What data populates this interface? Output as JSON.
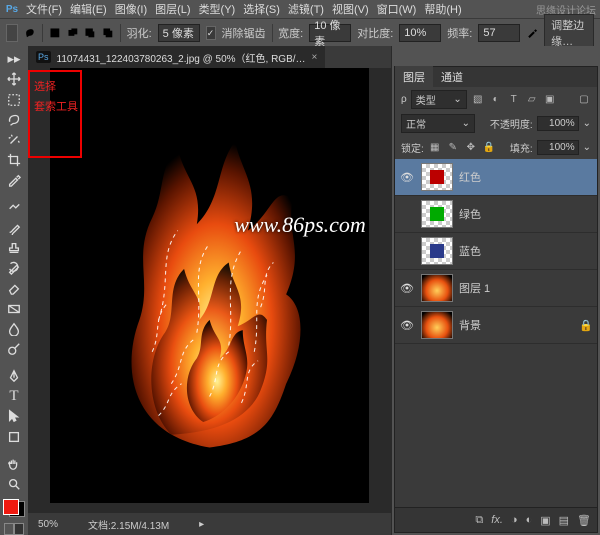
{
  "menubar": {
    "items": [
      "文件(F)",
      "编辑(E)",
      "图像(I)",
      "图层(L)",
      "类型(Y)",
      "选择(S)",
      "滤镜(T)",
      "视图(V)",
      "窗口(W)",
      "帮助(H)"
    ],
    "right_tag": "思缘设计论坛"
  },
  "options": {
    "feather_label": "羽化:",
    "feather_value": "5 像素",
    "antialias_label": "消除锯齿",
    "width_label": "宽度:",
    "width_value": "10 像素",
    "contrast_label": "对比度:",
    "contrast_value": "10%",
    "freq_label": "频率:",
    "freq_value": "57",
    "refine_btn": "调整边缘…"
  },
  "doc": {
    "tab_title": "11074431_122403780263_2.jpg @ 50%（红色, RGB/…",
    "zoom": "50%",
    "status": "文档:2.15M/4.13M"
  },
  "redbox": {
    "line1": "选择",
    "line2": "套索工具"
  },
  "watermark": "www.86ps.com",
  "layers_panel": {
    "tab_layers": "图层",
    "tab_channels": "通道",
    "kind_label": "类型",
    "blend_mode": "正常",
    "opacity_label": "不透明度:",
    "opacity": "100%",
    "lock_label": "锁定:",
    "fill_label": "填充:",
    "fill": "100%",
    "layers": [
      {
        "name": "红色",
        "color": "#b00",
        "visible": true,
        "checker": true,
        "selected": true
      },
      {
        "name": "绿色",
        "color": "#0a0",
        "visible": false,
        "checker": true
      },
      {
        "name": "蓝色",
        "color": "#2a3a8a",
        "visible": false,
        "checker": true
      },
      {
        "name": "图层 1",
        "color": "fire",
        "visible": true
      },
      {
        "name": "背景",
        "color": "fire",
        "visible": true,
        "locked": true
      }
    ]
  },
  "colors": {
    "fg": "#ef1a10",
    "bg": "#000000"
  }
}
